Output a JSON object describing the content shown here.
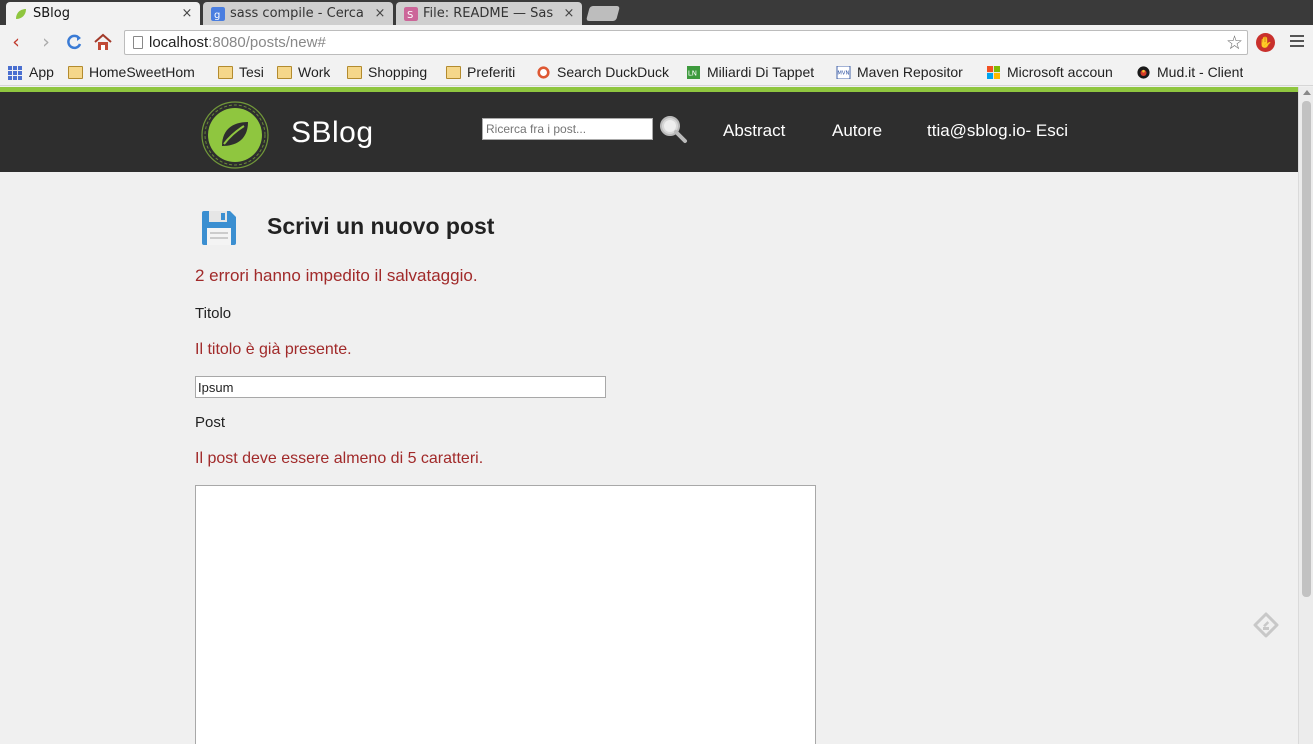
{
  "browser": {
    "tabs": [
      {
        "label": "SBlog",
        "active": true,
        "icon": "leaf-icon"
      },
      {
        "label": "sass compile - Cerca",
        "active": false,
        "icon": "google-icon"
      },
      {
        "label": "File: README — Sas",
        "active": false,
        "icon": "sass-icon"
      }
    ],
    "tab_close": "×",
    "url_host": "localhost",
    "url_rest": ":8080/posts/new#",
    "bookmarks": [
      {
        "label": "App",
        "icon": "apps-grid-icon"
      },
      {
        "label": "HomeSweetHom",
        "icon": "folder-icon"
      },
      {
        "label": "Tesi",
        "icon": "folder-icon"
      },
      {
        "label": "Work",
        "icon": "folder-icon"
      },
      {
        "label": "Shopping",
        "icon": "folder-icon"
      },
      {
        "label": "Preferiti",
        "icon": "folder-icon"
      },
      {
        "label": "Search DuckDuck",
        "icon": "duckduckgo-icon"
      },
      {
        "label": "Miliardi Di Tappet",
        "icon": "ln-icon"
      },
      {
        "label": "Maven Repositor",
        "icon": "mvn-icon"
      },
      {
        "label": "Microsoft accoun",
        "icon": "microsoft-icon"
      },
      {
        "label": "Mud.it - Client",
        "icon": "mud-icon"
      }
    ]
  },
  "site": {
    "title": "SBlog",
    "search_placeholder": "Ricerca fra i post...",
    "nav": {
      "abstract": "Abstract",
      "autore": "Autore",
      "user": "ttia@sblog.io- Esci"
    },
    "accent_color": "#8fc63f",
    "header_color": "#2e2e2e"
  },
  "form": {
    "heading": "Scrivi un nuovo post",
    "error_summary": "2 errori hanno impedito il salvataggio.",
    "title_label": "Titolo",
    "title_error": "Il titolo è già presente.",
    "title_value": "Ipsum",
    "post_label": "Post",
    "post_error": "Il post deve essere almeno di 5 caratteri.",
    "post_value": "",
    "error_color": "#a12a2a"
  }
}
